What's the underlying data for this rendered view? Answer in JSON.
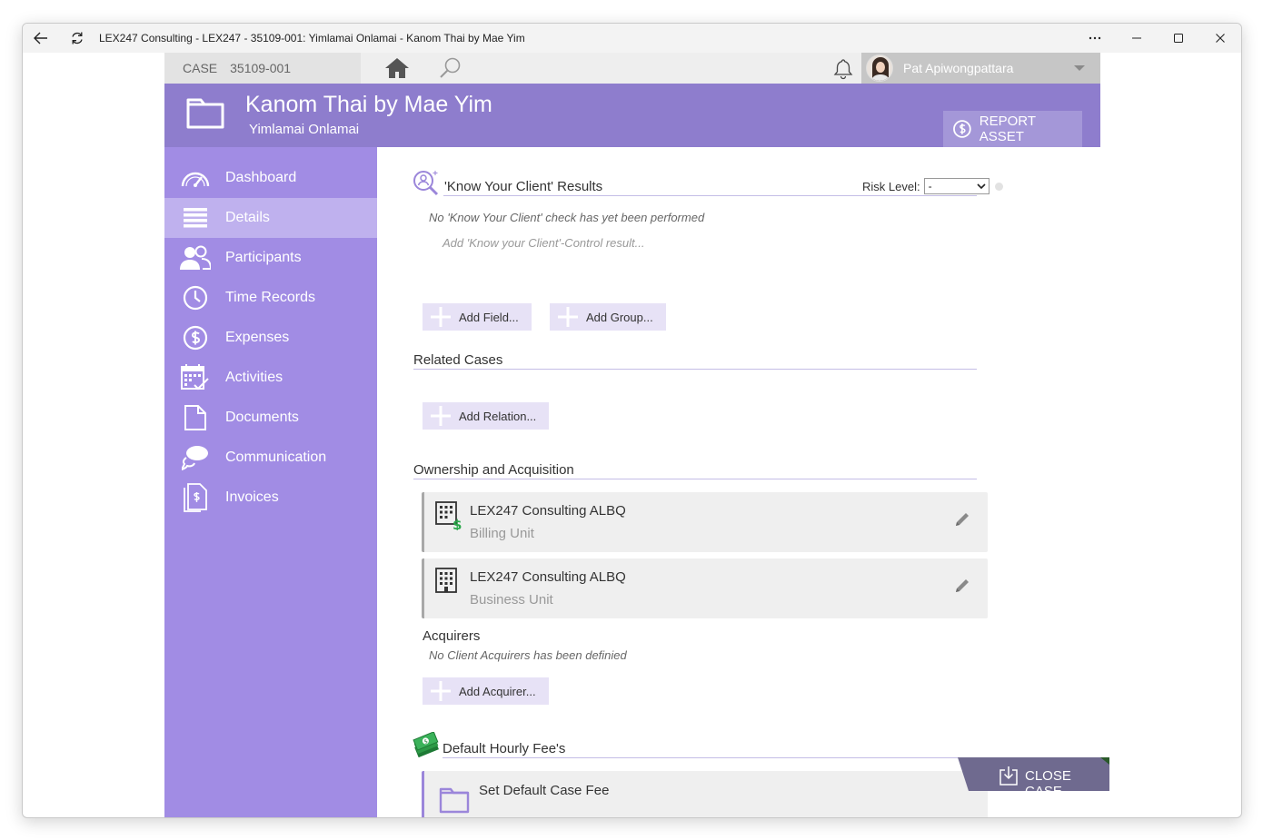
{
  "window": {
    "title": "LEX247 Consulting - LEX247 - 35109-001: Yimlamai Onlamai - Kanom Thai by Mae Yim"
  },
  "topbar": {
    "case_label": "CASE",
    "case_number": "35109-001",
    "user_name": "Pat Apiwongpattara"
  },
  "header": {
    "title": "Kanom Thai by Mae Yim",
    "subtitle": "Yimlamai Onlamai",
    "report_asset_label": "REPORT ASSET"
  },
  "sidebar": {
    "items": [
      {
        "label": "Dashboard",
        "icon": "gauge-icon"
      },
      {
        "label": "Details",
        "icon": "list-icon",
        "active": true
      },
      {
        "label": "Participants",
        "icon": "people-icon"
      },
      {
        "label": "Time Records",
        "icon": "clock-icon"
      },
      {
        "label": "Expenses",
        "icon": "dollar-circle-icon"
      },
      {
        "label": "Activities",
        "icon": "calendar-check-icon"
      },
      {
        "label": "Documents",
        "icon": "document-icon"
      },
      {
        "label": "Communication",
        "icon": "speech-bubble-icon"
      },
      {
        "label": "Invoices",
        "icon": "invoice-icon"
      }
    ]
  },
  "kyc": {
    "title": "'Know Your Client' Results",
    "risk_label": "Risk Level:",
    "risk_value": "-",
    "no_check_text": "No 'Know Your Client' check has yet been performed",
    "add_placeholder": "Add 'Know your Client'-Control result..."
  },
  "fields": {
    "add_field_label": "Add Field...",
    "add_group_label": "Add Group..."
  },
  "related": {
    "title": "Related Cases",
    "add_relation_label": "Add Relation..."
  },
  "ownership": {
    "title": "Ownership and Acquisition",
    "cards": [
      {
        "name": "LEX247 Consulting ALBQ",
        "type": "Billing Unit"
      },
      {
        "name": "LEX247 Consulting ALBQ",
        "type": "Business Unit"
      }
    ],
    "acquirers_title": "Acquirers",
    "no_acquirers_text": "No Client Acquirers has been definied",
    "add_acquirer_label": "Add Acquirer..."
  },
  "fees": {
    "title": "Default Hourly Fee's",
    "set_default_label": "Set Default Case Fee"
  },
  "close_case_label": "CLOSE CASE",
  "colors": {
    "header": "#8e7dcd",
    "sidebar": "#a18ce4",
    "sidebar_active": "#bfb1ee",
    "close_case": "#6f6a8f"
  }
}
